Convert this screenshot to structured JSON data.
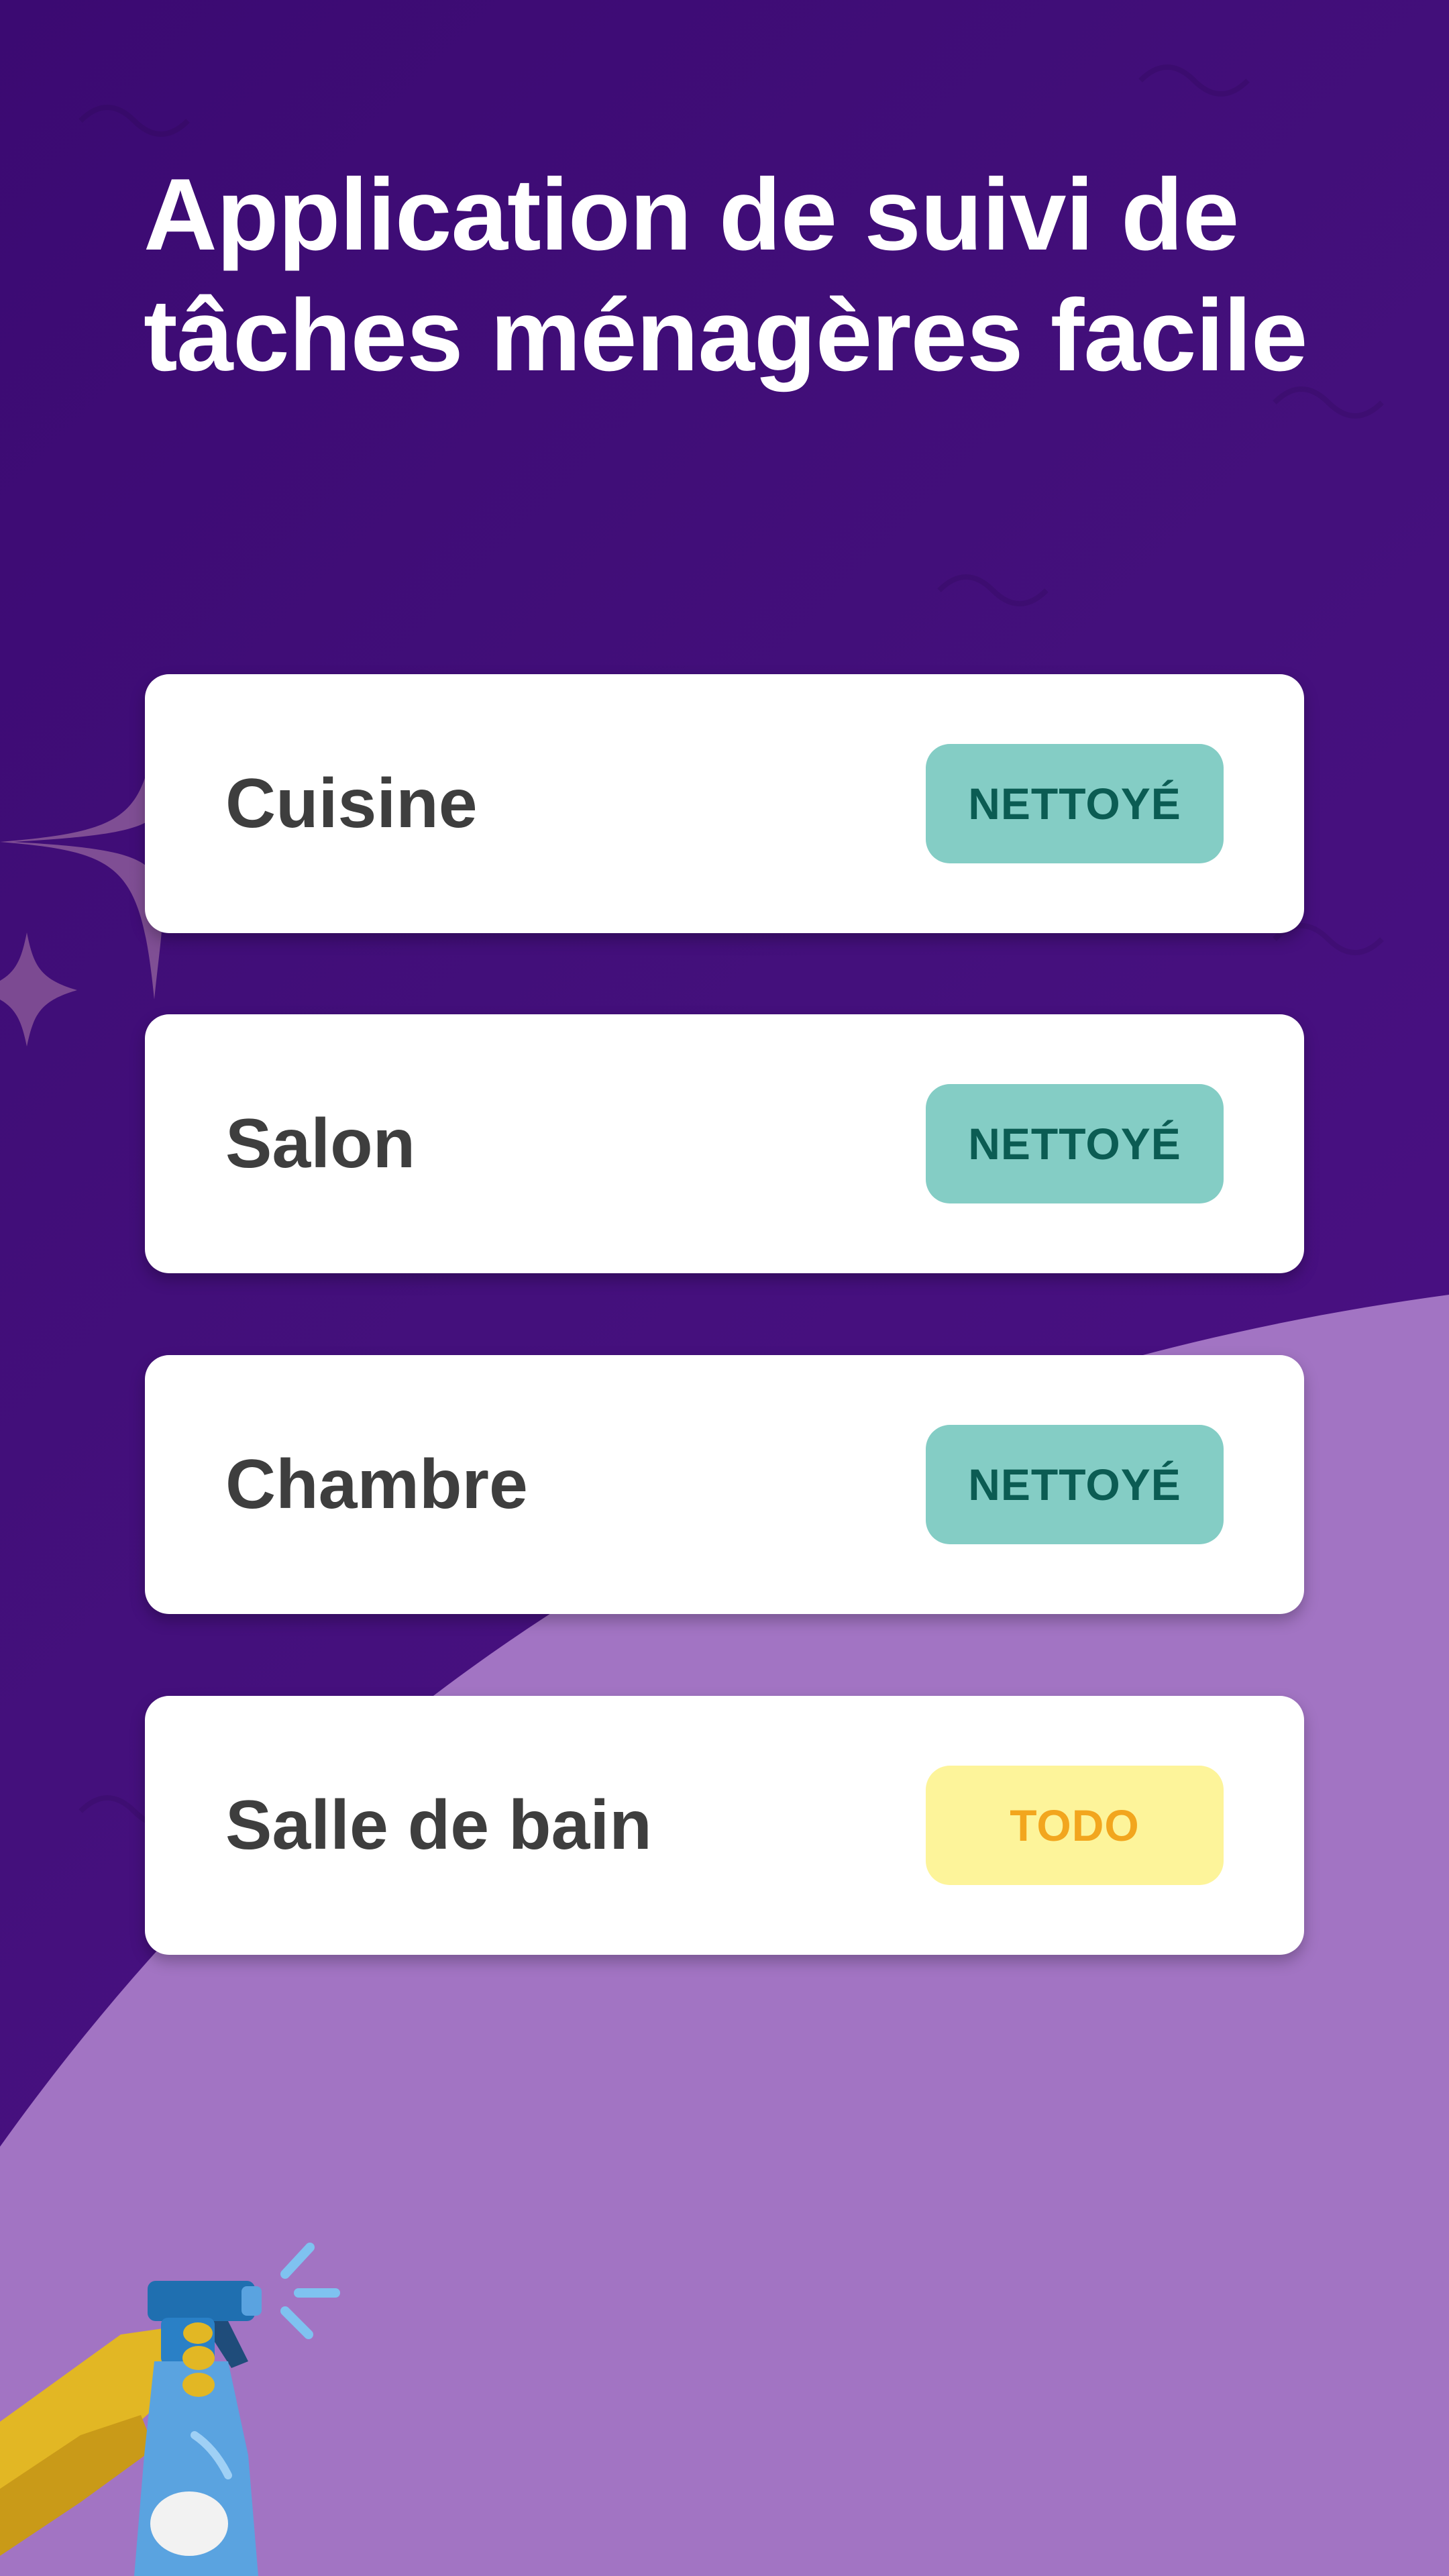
{
  "header": {
    "title": "Application de suivi de tâches ménagères facile"
  },
  "rooms": [
    {
      "name": "Cuisine",
      "status": "NETTOYÉ",
      "state": "done"
    },
    {
      "name": "Salon",
      "status": "NETTOYÉ",
      "state": "done"
    },
    {
      "name": "Chambre",
      "status": "NETTOYÉ",
      "state": "done"
    },
    {
      "name": "Salle de bain",
      "status": "TODO",
      "state": "todo"
    }
  ],
  "colors": {
    "background": "#44107c",
    "lavender_wave": "#a274c3",
    "done_badge": "#84cdc5",
    "done_text": "#0b5c53",
    "todo_badge": "#fdf49a",
    "todo_text": "#f2a61e"
  },
  "icons": {
    "sparkle": "sparkle-icon",
    "spray_bottle": "spray-bottle-icon"
  }
}
